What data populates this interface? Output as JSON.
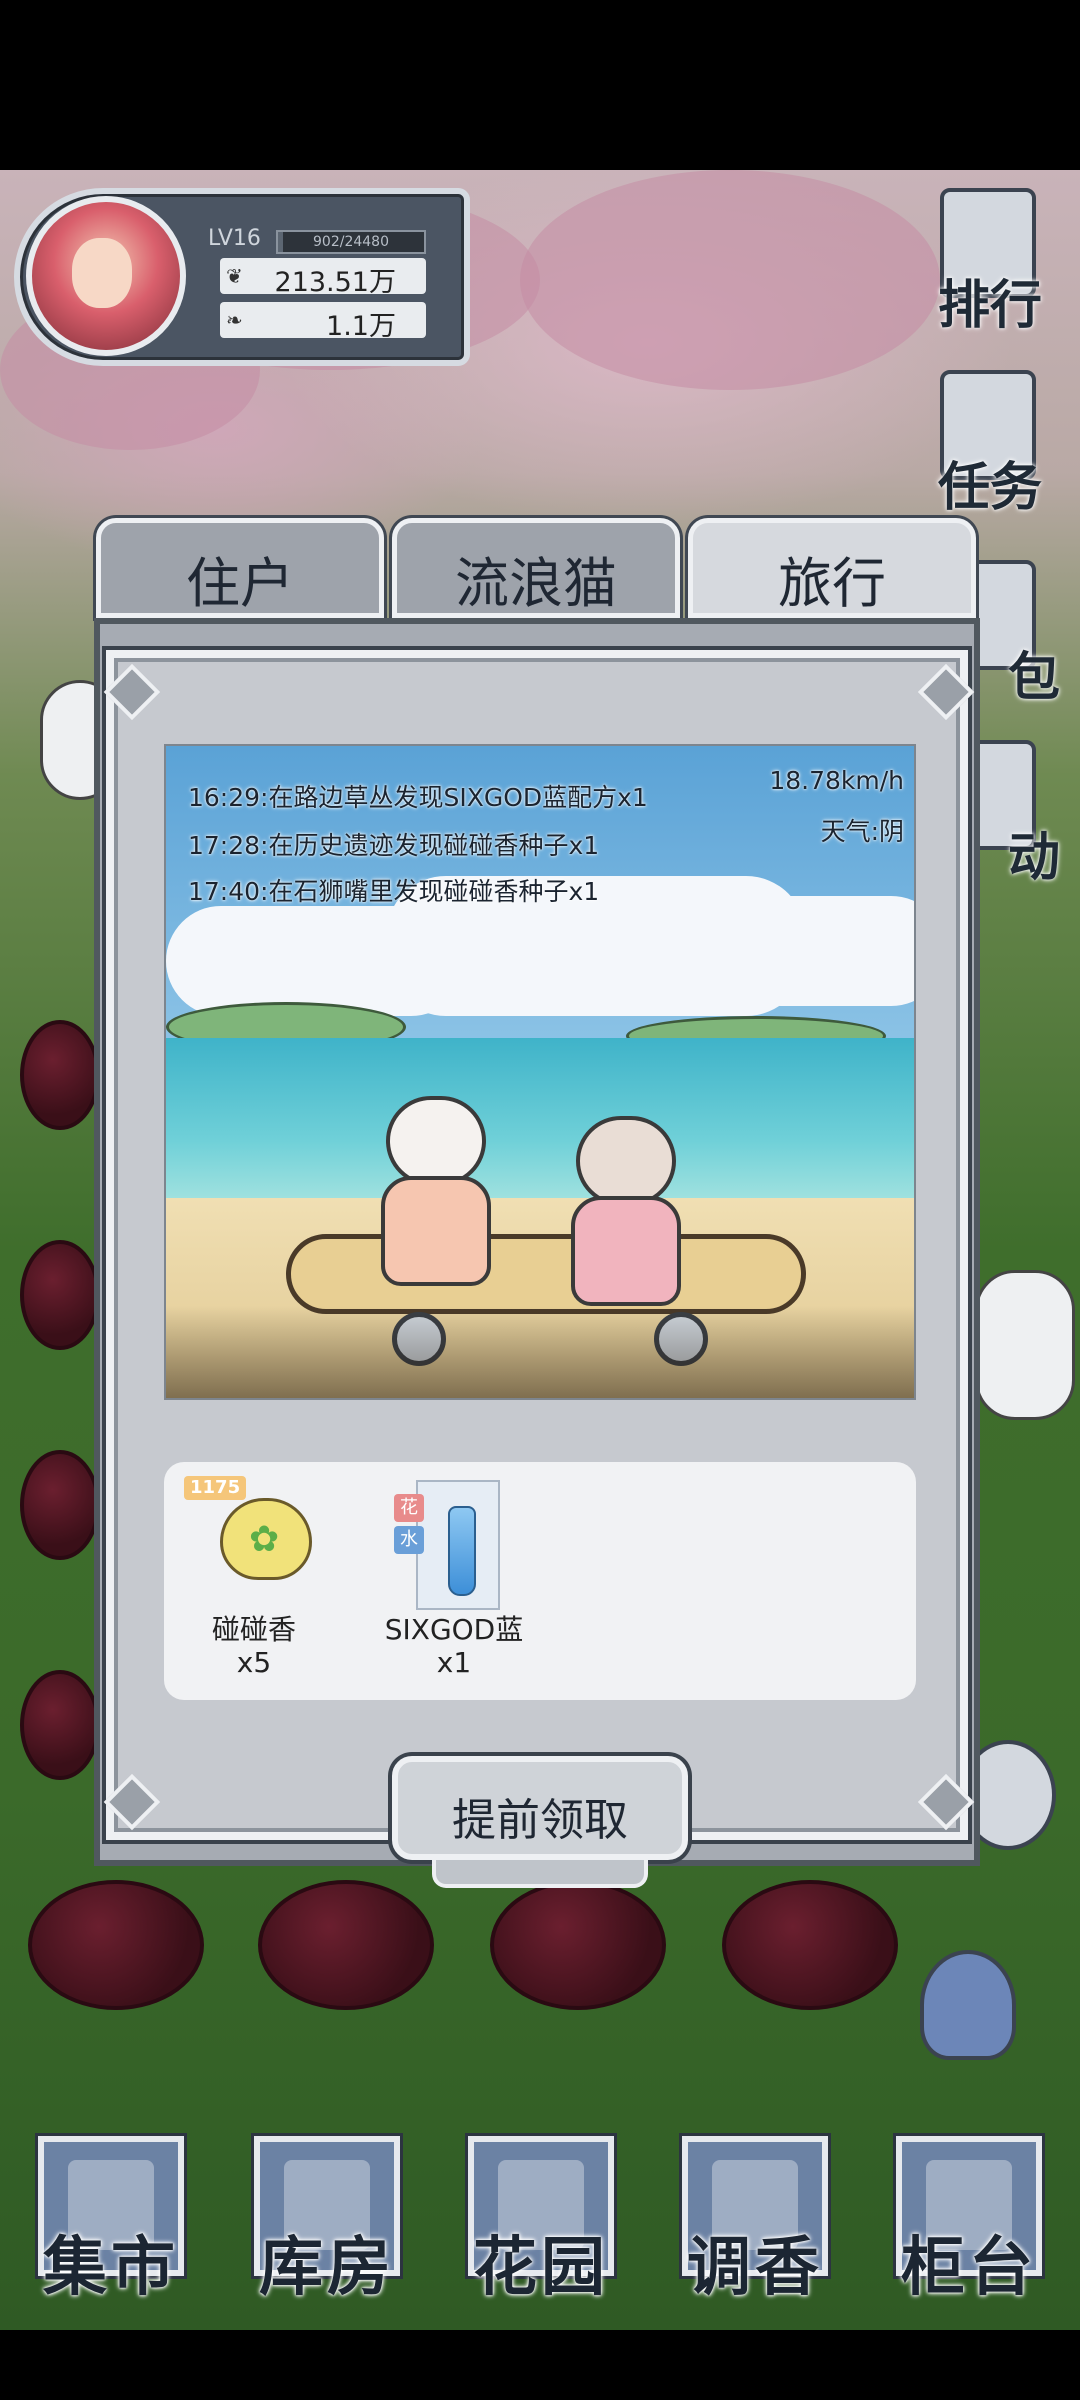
{
  "profile": {
    "level": "LV16",
    "xp_text": "902/24480",
    "xp_progress": 0.037,
    "currency_primary": "213.51万",
    "currency_secondary": "1.1万",
    "icon_primary": "heart-drops-icon",
    "icon_secondary": "leaf-drops-icon"
  },
  "side_menu": [
    {
      "label": "排行"
    },
    {
      "label": "任务"
    },
    {
      "label": "包"
    },
    {
      "label": "动"
    }
  ],
  "tabs": [
    {
      "label": "住户",
      "active": false
    },
    {
      "label": "流浪猫",
      "active": false
    },
    {
      "label": "旅行",
      "active": true
    }
  ],
  "travel": {
    "log": [
      "16:29:在路边草丛发现SIXGOD蓝配方x1",
      "17:28:在历史遗迹发现碰碰香种子x1",
      "17:40:在石狮嘴里发现碰碰香种子x1"
    ],
    "speed": "18.78km/h",
    "weather": "天气:阴"
  },
  "rewards": [
    {
      "name": "碰碰香",
      "qty": "x5",
      "badge": "1175",
      "icon": "seed-bag-icon"
    },
    {
      "name": "SIXGOD蓝",
      "qty": "x1",
      "tag_top": "花",
      "tag_bottom": "水",
      "icon": "perfume-bottle-icon"
    }
  ],
  "claim_button": "提前领取",
  "bottom_nav": [
    {
      "label": "集市"
    },
    {
      "label": "库房"
    },
    {
      "label": "花园"
    },
    {
      "label": "调香"
    },
    {
      "label": "柜台"
    }
  ],
  "colors": {
    "frame": "#eef0f3",
    "panel": "#c6c9cf",
    "accent_tag_red": "#e88b8b",
    "accent_tag_blue": "#6a9fd8"
  }
}
